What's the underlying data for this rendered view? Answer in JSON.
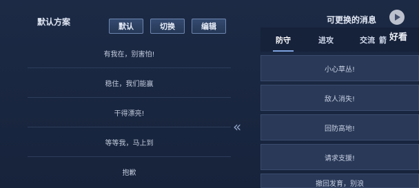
{
  "left_panel": {
    "title": "默认方案",
    "buttons": [
      "默认",
      "切换",
      "编辑"
    ],
    "rows": [
      "有我在，别害怕!",
      "稳住，我们能赢",
      "干得漂亮!",
      "等等我，马上到",
      "抱歉"
    ]
  },
  "right_panel": {
    "title": "可更换的消息",
    "tabs": [
      "防守",
      "进攻",
      "交流",
      "箭"
    ],
    "items": [
      "小心草丛!",
      "敌人消失!",
      "回防高地!",
      "请求支援!",
      "撤回发育，别浪"
    ]
  },
  "watermark": {
    "brand": "好看"
  },
  "icons": {
    "transfer": "double-chevron-left-icon",
    "logo": "play-logo-icon"
  }
}
